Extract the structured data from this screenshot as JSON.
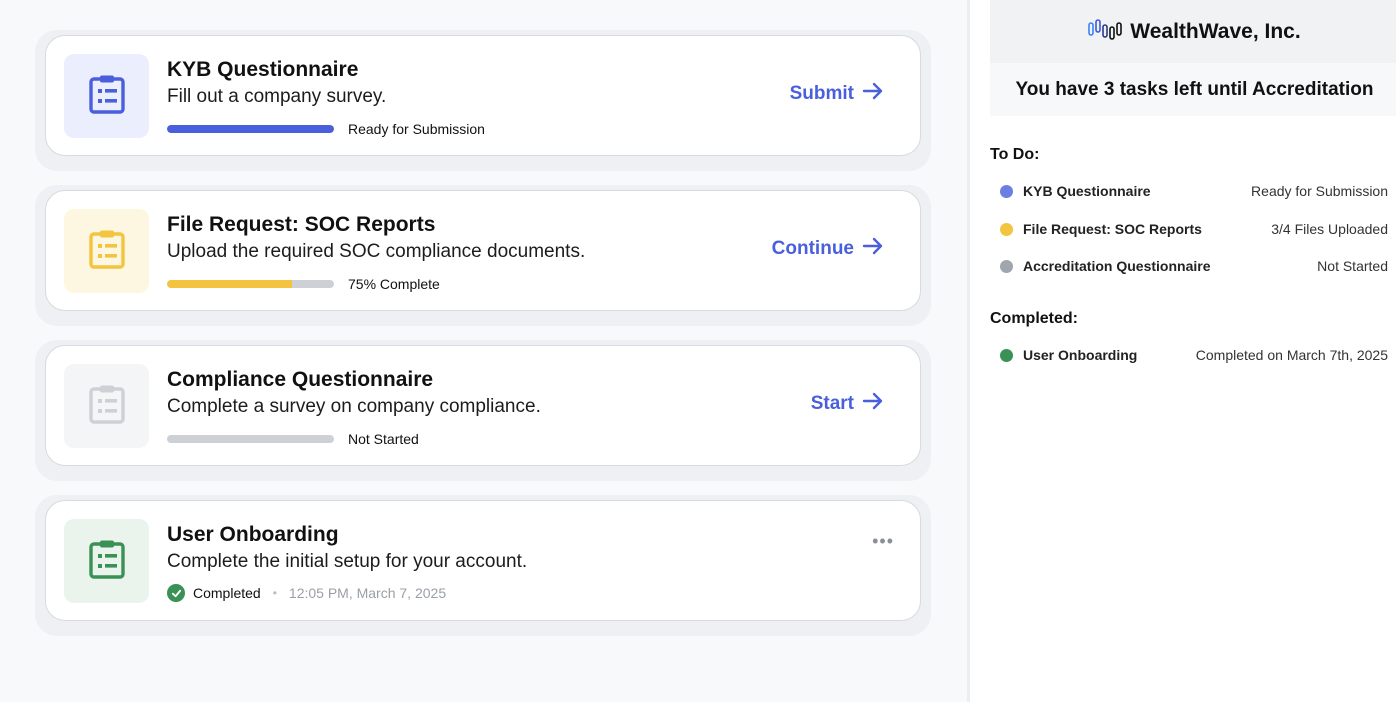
{
  "tasks": [
    {
      "title": "KYB Questionnaire",
      "subtitle": "Fill out a company survey.",
      "status": "Ready for Submission",
      "progress": 1.0,
      "action": "Submit",
      "tile_bg": "#ebeefc",
      "icon_color": "#4a5fdc",
      "bar_color": "#4a5fdc"
    },
    {
      "title": "File Request: SOC Reports",
      "subtitle": "Upload the required SOC compliance documents.",
      "status": "75% Complete",
      "progress": 0.75,
      "action": "Continue",
      "tile_bg": "#fdf6e1",
      "icon_color": "#f2c440",
      "bar_color": "#f2c440"
    },
    {
      "title": "Compliance Questionnaire",
      "subtitle": "Complete a survey on company compliance.",
      "status": "Not Started",
      "progress": 0,
      "action": "Start",
      "tile_bg": "#f4f5f6",
      "icon_color": "#cdd1d6",
      "bar_color": "#cdd1d6"
    },
    {
      "title": "User Onboarding",
      "subtitle": "Complete the initial setup for your account.",
      "status": "Completed",
      "timestamp": "12:05 PM, March 7, 2025",
      "tile_bg": "#eaf4ed",
      "icon_color": "#3a9155",
      "more_label": "•••"
    }
  ],
  "sidebar": {
    "brand": "WealthWave, Inc.",
    "logo_icon": "bar-chart-logo-icon",
    "banner": "You have 3 tasks left until Accreditation",
    "todo_title": "To Do:",
    "todo": [
      {
        "name": "KYB Questionnaire",
        "status": "Ready for Submission",
        "color": "#6b7fe3"
      },
      {
        "name": "File Request: SOC Reports",
        "status": "3/4 Files Uploaded",
        "color": "#f2c440"
      },
      {
        "name": "Accreditation Questionnaire",
        "status": "Not Started",
        "color": "#a0a6ae"
      }
    ],
    "completed_title": "Completed:",
    "completed": [
      {
        "name": "User Onboarding",
        "status": "Completed on March 7th, 2025",
        "color": "#3a9155"
      }
    ]
  },
  "icons": {
    "task_icon": "clipboard-list-icon",
    "action_icon": "arrow-right-icon",
    "check_icon": "check-circle-icon",
    "more_icon": "more-horizontal-icon"
  }
}
